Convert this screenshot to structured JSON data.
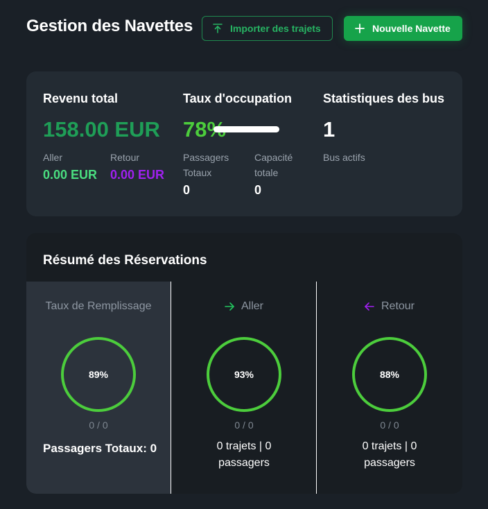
{
  "header": {
    "title": "Gestion des Navettes",
    "import_label": "Importer des trajets",
    "new_label": "Nouvelle Navette"
  },
  "revenue": {
    "title": "Revenu total",
    "total": "158.00 EUR",
    "aller_label": "Aller",
    "aller_value": "0.00 EUR",
    "retour_label": "Retour",
    "retour_value": "0.00 EUR"
  },
  "occupancy": {
    "title": "Taux d'occupation",
    "rate": "78%",
    "bar_fill_fraction": 1.0,
    "passengers_label_line1": "Passagers",
    "passengers_label_line2": "Totaux",
    "passengers_value": "0",
    "capacity_label_line1": "Capacité",
    "capacity_label_line2": "totale",
    "capacity_value": "0"
  },
  "bus_stats": {
    "title": "Statistiques des bus",
    "active_count": "1",
    "active_label": "Bus actifs"
  },
  "reservations": {
    "title": "Résumé des Réservations",
    "panels": [
      {
        "title": "Taux de Remplissage",
        "percent": "89%",
        "ratio": "0 / 0",
        "footer": "Passagers Totaux: 0"
      },
      {
        "title": "Aller",
        "icon": "arrow-right-icon",
        "percent": "93%",
        "ratio": "0 / 0",
        "footer_line1": "0 trajets | 0",
        "footer_line2": "passagers"
      },
      {
        "title": "Retour",
        "icon": "arrow-left-icon",
        "percent": "88%",
        "ratio": "0 / 0",
        "footer_line1": "0 trajets | 0",
        "footer_line2": "passagers"
      }
    ]
  },
  "colors": {
    "accent_green": "#16a34a",
    "value_green": "#1f9e57",
    "light_green": "#4ade80",
    "purple": "#a020f0",
    "ring_green": "#4ccd3c"
  }
}
